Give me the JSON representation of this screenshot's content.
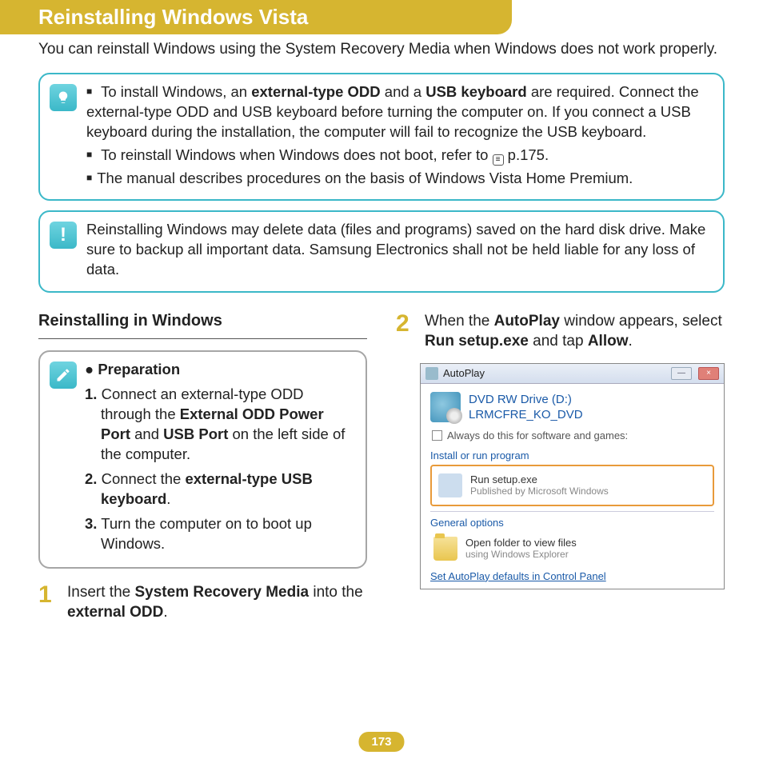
{
  "header": {
    "title": "Reinstalling Windows Vista"
  },
  "intro": "You can reinstall Windows using the System Recovery Media when Windows does not work properly.",
  "tipbox": {
    "item1_pre": "To install Windows, an ",
    "item1_b1": "external-type ODD",
    "item1_mid": " and a ",
    "item1_b2": "USB keyboard",
    "item1_post": " are required. Connect the external-type ODD and USB keyboard before turning the computer on. If you connect a USB keyboard during the installation, the computer will fail to recognize the USB keyboard.",
    "item2_pre": "To reinstall Windows when Windows does not boot, refer to ",
    "item2_link": " p.175.",
    "item3": "The manual describes procedures on the basis of Windows Vista Home Premium."
  },
  "warnbox": {
    "text": "Reinstalling Windows may delete data (files and programs) saved on the hard disk drive. Make sure to backup all important data. Samsung Electronics shall not be held liable for any loss of data."
  },
  "left": {
    "section_title": "Reinstalling in Windows",
    "prep_title": "Preparation",
    "p1_num": "1.",
    "p1_pre": " Connect an external-type ODD through the ",
    "p1_b1": "External ODD Power Port",
    "p1_mid": " and ",
    "p1_b2": "USB Port",
    "p1_post": " on the left side of the computer.",
    "p2_num": "2.",
    "p2_pre": " Connect the ",
    "p2_b1": "external-type USB keyboard",
    "p2_post": ".",
    "p3_num": "3.",
    "p3_text": " Turn the computer on to boot up Windows.",
    "step1_num": "1",
    "step1_pre": "Insert the ",
    "step1_b1": "System Recovery Media",
    "step1_mid": " into the ",
    "step1_b2": "external ODD",
    "step1_post": "."
  },
  "right": {
    "step2_num": "2",
    "step2_pre": "When the ",
    "step2_b1": "AutoPlay",
    "step2_mid": " window appears, select ",
    "step2_b2": "Run setup.exe",
    "step2_mid2": " and tap ",
    "step2_b3": "Allow",
    "step2_post": ".",
    "window": {
      "title": "AutoPlay",
      "drive_line1": "DVD RW Drive (D:)",
      "drive_line2": "LRMCFRE_KO_DVD",
      "checkbox": "Always do this for software and games:",
      "group1": "Install or run program",
      "opt1_main": "Run setup.exe",
      "opt1_sub": "Published by Microsoft Windows",
      "group2": "General options",
      "opt2_main": "Open folder to view files",
      "opt2_sub": "using Windows Explorer",
      "cp_link": "Set AutoPlay defaults in Control Panel",
      "min_btn": "—",
      "close_btn": "×"
    }
  },
  "page_number": "173"
}
